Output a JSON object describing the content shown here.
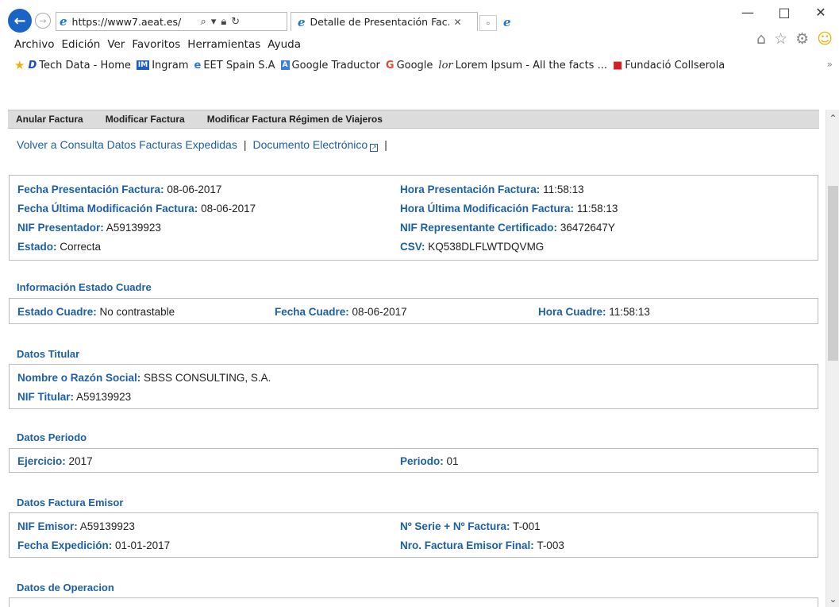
{
  "browser": {
    "url": "https://www7.aeat.es/",
    "tab_title": "Detalle de Presentación Fac...",
    "win_min": "—",
    "win_max": "□",
    "win_close": "✕",
    "menu": [
      "Archivo",
      "Edición",
      "Ver",
      "Favoritos",
      "Herramientas",
      "Ayuda"
    ],
    "favorites": [
      {
        "icon": "D",
        "label": "Tech Data - Home",
        "color": "#1b4dbd"
      },
      {
        "icon": "IM",
        "label": "Ingram",
        "color": "#1f5fbf"
      },
      {
        "icon": "e",
        "label": "EET Spain S.A",
        "color": "#2a7bd0"
      },
      {
        "icon": "A",
        "label": "Google Traductor",
        "color": "#3b7de0"
      },
      {
        "icon": "G",
        "label": "Google",
        "color": "#dd4b39"
      },
      {
        "icon": "lor",
        "label": "Lorem Ipsum - All the facts ...",
        "color": "#333333"
      },
      {
        "icon": "■",
        "label": "Fundació Collserola",
        "color": "#d62020"
      }
    ]
  },
  "toolbar": {
    "anular": "Anular Factura",
    "modificar": "Modificar Factura",
    "modificar_viajeros": "Modificar Factura Régimen de Viajeros"
  },
  "links": {
    "volver": "Volver a Consulta Datos Facturas Expedidas",
    "documento": "Documento Electrónico"
  },
  "presentacion": {
    "fecha_label": "Fecha Presentación Factura:",
    "fecha_value": "08-06-2017",
    "hora_label": "Hora Presentación Factura:",
    "hora_value": "11:58:13",
    "fecha_mod_label": "Fecha Última Modificación Factura:",
    "fecha_mod_value": "08-06-2017",
    "hora_mod_label": "Hora Última Modificación Factura:",
    "hora_mod_value": "11:58:13",
    "nif_pres_label": "NIF Presentador:",
    "nif_pres_value": "A59139923",
    "nif_rep_label": "NIF Representante Certificado:",
    "nif_rep_value": "36472647Y",
    "estado_label": "Estado:",
    "estado_value": "Correcta",
    "csv_label": "CSV:",
    "csv_value": "KQ538DLFLWTDQVMG"
  },
  "cuadre": {
    "title": "Información Estado Cuadre",
    "estado_label": "Estado Cuadre:",
    "estado_value": "No contrastable",
    "fecha_label": "Fecha Cuadre:",
    "fecha_value": "08-06-2017",
    "hora_label": "Hora Cuadre:",
    "hora_value": "11:58:13"
  },
  "titular": {
    "title": "Datos Titular",
    "nombre_label": "Nombre o Razón Social:",
    "nombre_value": "SBSS CONSULTING, S.A.",
    "nif_label": "NIF Titular:",
    "nif_value": "A59139923"
  },
  "periodo": {
    "title": "Datos Periodo",
    "ejercicio_label": "Ejercicio:",
    "ejercicio_value": "2017",
    "periodo_label": "Periodo:",
    "periodo_value": "01"
  },
  "emisor": {
    "title": "Datos Factura Emisor",
    "nif_label": "NIF Emisor:",
    "nif_value": "A59139923",
    "serie_label": "Nº Serie + Nº Factura:",
    "serie_value": "T-001",
    "fecha_label": "Fecha Expedición:",
    "fecha_value": "01-01-2017",
    "final_label": "Nro. Factura Emisor Final:",
    "final_value": "T-003"
  },
  "operacion": {
    "title": "Datos de Operacion"
  }
}
